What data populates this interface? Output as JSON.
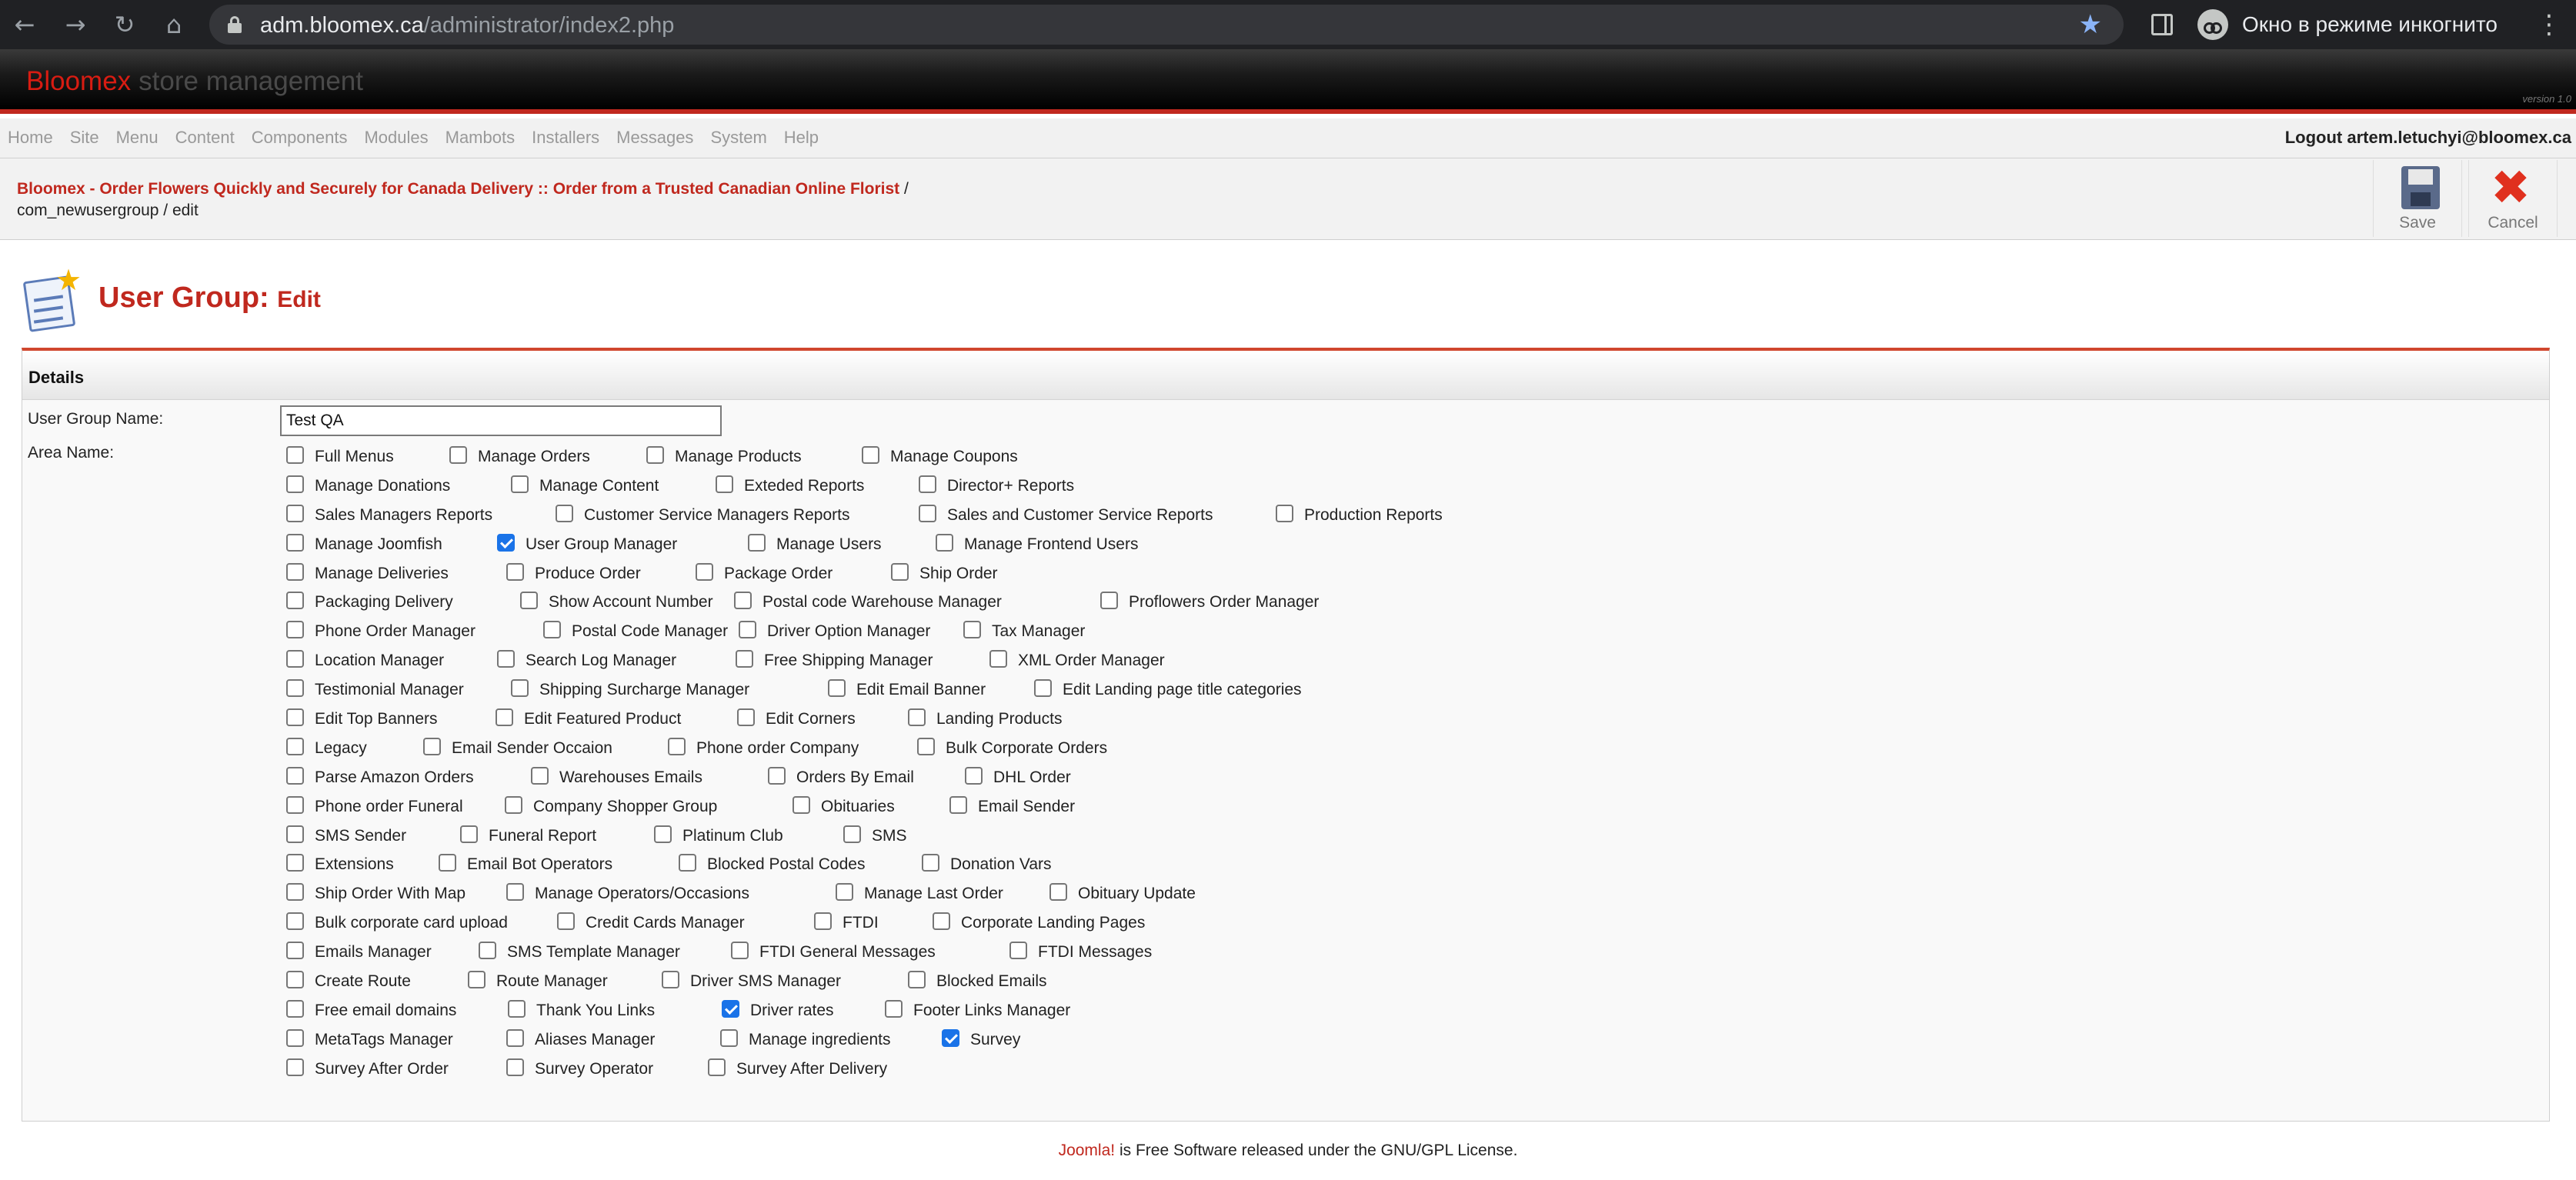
{
  "browser": {
    "url_host": "adm.bloomex.ca",
    "url_path": "/administrator/index2.php",
    "incognito_label": "Окно в режиме инкогнито",
    "icons": [
      "back-icon",
      "forward-icon",
      "reload-icon",
      "home-icon",
      "lock-icon",
      "bookmark-star-icon",
      "side-panel-icon",
      "incognito-icon",
      "menu-kebab-icon"
    ]
  },
  "banner": {
    "brand": "Bloomex",
    "subtitle": "store management",
    "version": "version 1.0"
  },
  "menu": {
    "items": [
      "Home",
      "Site",
      "Menu",
      "Content",
      "Components",
      "Modules",
      "Mambots",
      "Installers",
      "Messages",
      "System",
      "Help"
    ],
    "logout": "Logout artem.letuchyi@bloomex.ca"
  },
  "toolbar": {
    "site_link": "Bloomex - Order Flowers Quickly and Securely for Canada Delivery :: Order from a Trusted Canadian Online Florist",
    "separator": "/",
    "path": "com_newusergroup / edit",
    "save_label": "Save",
    "cancel_label": "Cancel"
  },
  "page": {
    "title": "User Group:",
    "subtitle": "Edit",
    "details_header": "Details",
    "group_name_label": "User Group Name:",
    "group_name_value": "Test QA",
    "area_name_label": "Area Name:"
  },
  "areas": [
    [
      {
        "label": "Full Menus",
        "checked": false
      },
      {
        "label": "Manage Orders",
        "checked": false
      },
      {
        "label": "Manage Products",
        "checked": false
      },
      {
        "label": "Manage Coupons",
        "checked": false
      }
    ],
    [
      {
        "label": "Manage Donations",
        "checked": false
      },
      {
        "label": "Manage Content",
        "checked": false
      },
      {
        "label": "Exteded Reports",
        "checked": false
      },
      {
        "label": "Director+ Reports",
        "checked": false
      }
    ],
    [
      {
        "label": "Sales Managers Reports",
        "checked": false
      },
      {
        "label": "Customer Service Managers Reports",
        "checked": false
      },
      {
        "label": "Sales and Customer Service Reports",
        "checked": false
      },
      {
        "label": "Production Reports",
        "checked": false
      }
    ],
    [
      {
        "label": "Manage Joomfish",
        "checked": false
      },
      {
        "label": "User Group Manager",
        "checked": true
      },
      {
        "label": "Manage Users",
        "checked": false
      },
      {
        "label": "Manage Frontend Users",
        "checked": false
      }
    ],
    [
      {
        "label": "Manage Deliveries",
        "checked": false
      },
      {
        "label": "Produce Order",
        "checked": false
      },
      {
        "label": "Package Order",
        "checked": false
      },
      {
        "label": "Ship Order",
        "checked": false
      }
    ],
    [
      {
        "label": "Packaging Delivery",
        "checked": false
      },
      {
        "label": "Show Account Number",
        "checked": false
      },
      {
        "label": "Postal code Warehouse Manager",
        "checked": false
      },
      {
        "label": "Proflowers Order Manager",
        "checked": false
      }
    ],
    [
      {
        "label": "Phone Order Manager",
        "checked": false
      },
      {
        "label": "Postal Code Manager",
        "checked": false
      },
      {
        "label": "Driver Option Manager",
        "checked": false
      },
      {
        "label": "Tax Manager",
        "checked": false
      }
    ],
    [
      {
        "label": "Location Manager",
        "checked": false
      },
      {
        "label": "Search Log Manager",
        "checked": false
      },
      {
        "label": "Free Shipping Manager",
        "checked": false
      },
      {
        "label": "XML Order Manager",
        "checked": false
      }
    ],
    [
      {
        "label": "Testimonial Manager",
        "checked": false
      },
      {
        "label": "Shipping Surcharge Manager",
        "checked": false
      },
      {
        "label": "Edit Email Banner",
        "checked": false
      },
      {
        "label": "Edit Landing page title categories",
        "checked": false
      }
    ],
    [
      {
        "label": "Edit Top Banners",
        "checked": false
      },
      {
        "label": "Edit Featured Product",
        "checked": false
      },
      {
        "label": "Edit Corners",
        "checked": false
      },
      {
        "label": "Landing Products",
        "checked": false
      }
    ],
    [
      {
        "label": "Legacy",
        "checked": false
      },
      {
        "label": "Email Sender Occaion",
        "checked": false
      },
      {
        "label": "Phone order Company",
        "checked": false
      },
      {
        "label": "Bulk Corporate Orders",
        "checked": false
      }
    ],
    [
      {
        "label": "Parse Amazon Orders",
        "checked": false
      },
      {
        "label": "Warehouses Emails",
        "checked": false
      },
      {
        "label": "Orders By Email",
        "checked": false
      },
      {
        "label": "DHL Order",
        "checked": false
      }
    ],
    [
      {
        "label": "Phone order Funeral",
        "checked": false
      },
      {
        "label": "Company Shopper Group",
        "checked": false
      },
      {
        "label": "Obituaries",
        "checked": false
      },
      {
        "label": "Email Sender",
        "checked": false
      }
    ],
    [
      {
        "label": "SMS Sender",
        "checked": false
      },
      {
        "label": "Funeral Report",
        "checked": false
      },
      {
        "label": "Platinum Club",
        "checked": false
      },
      {
        "label": "SMS",
        "checked": false
      }
    ],
    [
      {
        "label": "Extensions",
        "checked": false
      },
      {
        "label": "Email Bot Operators",
        "checked": false
      },
      {
        "label": "Blocked Postal Codes",
        "checked": false
      },
      {
        "label": "Donation Vars",
        "checked": false
      }
    ],
    [
      {
        "label": "Ship Order With Map",
        "checked": false
      },
      {
        "label": "Manage Operators/Occasions",
        "checked": false
      },
      {
        "label": "Manage Last Order",
        "checked": false
      },
      {
        "label": "Obituary Update",
        "checked": false
      }
    ],
    [
      {
        "label": "Bulk corporate card upload",
        "checked": false
      },
      {
        "label": "Credit Cards Manager",
        "checked": false
      },
      {
        "label": "FTDI",
        "checked": false
      },
      {
        "label": "Corporate Landing Pages",
        "checked": false
      }
    ],
    [
      {
        "label": "Emails Manager",
        "checked": false
      },
      {
        "label": "SMS Template Manager",
        "checked": false
      },
      {
        "label": "FTDI General Messages",
        "checked": false
      },
      {
        "label": "FTDI Messages",
        "checked": false
      }
    ],
    [
      {
        "label": "Create Route",
        "checked": false
      },
      {
        "label": "Route Manager",
        "checked": false
      },
      {
        "label": "Driver SMS Manager",
        "checked": false
      },
      {
        "label": "Blocked Emails",
        "checked": false
      }
    ],
    [
      {
        "label": "Free email domains",
        "checked": false
      },
      {
        "label": "Thank You Links",
        "checked": false
      },
      {
        "label": "Driver rates",
        "checked": true
      },
      {
        "label": "Footer Links Manager",
        "checked": false
      }
    ],
    [
      {
        "label": "MetaTags Manager",
        "checked": false
      },
      {
        "label": "Aliases Manager",
        "checked": false
      },
      {
        "label": "Manage ingredients",
        "checked": false
      },
      {
        "label": "Survey",
        "checked": true
      }
    ],
    [
      {
        "label": "Survey After Order",
        "checked": false
      },
      {
        "label": "Survey Operator",
        "checked": false
      },
      {
        "label": "Survey After Delivery",
        "checked": false
      }
    ]
  ],
  "footer": {
    "joomla": "Joomla!",
    "text": " is Free Software released under the GNU/GPL License."
  }
}
